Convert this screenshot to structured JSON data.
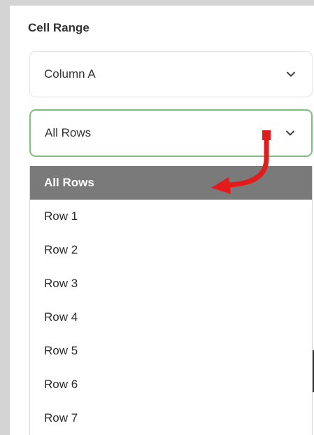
{
  "section": {
    "title": "Cell Range"
  },
  "column_select": {
    "value": "Column A",
    "icon": "chevron-down-icon"
  },
  "rows_select": {
    "value": "All Rows",
    "icon": "chevron-down-icon",
    "focus_color": "#7fbf7f"
  },
  "dropdown": {
    "options": [
      {
        "label": "All Rows"
      },
      {
        "label": "Row 1"
      },
      {
        "label": "Row 2"
      },
      {
        "label": "Row 3"
      },
      {
        "label": "Row 4"
      },
      {
        "label": "Row 5"
      },
      {
        "label": "Row 6"
      },
      {
        "label": "Row 7"
      }
    ],
    "selected_index": 0,
    "highlight_color": "#7a7a7a"
  },
  "annotation": {
    "icon": "curved-arrow-icon",
    "color": "#e31b1b"
  }
}
